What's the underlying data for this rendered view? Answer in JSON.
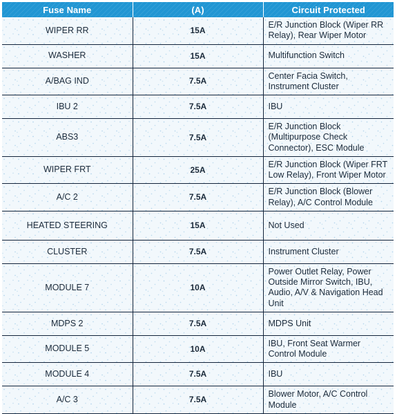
{
  "table": {
    "name": "fuse-relay-table",
    "accent_color": "#2196d3",
    "border_color": "#12233a",
    "body_background": "#f2f8fc",
    "header_text_color": "#ffffff",
    "columns": [
      {
        "key": "fuse_name",
        "label": "Fuse Name"
      },
      {
        "key": "amperage",
        "label": "(A)"
      },
      {
        "key": "circuit_protected",
        "label": "Circuit Protected"
      }
    ],
    "rows": [
      {
        "fuse_name": "WIPER RR",
        "amperage": "15A",
        "circuit_protected": "E/R Junction Block (Wiper RR Relay), Rear Wiper Motor"
      },
      {
        "fuse_name": "WASHER",
        "amperage": "15A",
        "circuit_protected": "Multifunction Switch"
      },
      {
        "fuse_name": "A/BAG IND",
        "amperage": "7.5A",
        "circuit_protected": "Center Facia Switch, Instrument Cluster"
      },
      {
        "fuse_name": "IBU 2",
        "amperage": "7.5A",
        "circuit_protected": "IBU"
      },
      {
        "fuse_name": "ABS3",
        "amperage": "7.5A",
        "circuit_protected": "E/R Junction Block (Multipurpose Check Connector), ESC Module"
      },
      {
        "fuse_name": "WIPER FRT",
        "amperage": "25A",
        "circuit_protected": "E/R Junction Block (Wiper FRT Low Relay), Front Wiper Motor"
      },
      {
        "fuse_name": "A/C 2",
        "amperage": "7.5A",
        "circuit_protected": "E/R Junction Block (Blower Relay), A/C Control Module"
      },
      {
        "fuse_name": "HEATED STEERING",
        "amperage": "15A",
        "circuit_protected": "Not Used"
      },
      {
        "fuse_name": "CLUSTER",
        "amperage": "7.5A",
        "circuit_protected": "Instrument Cluster"
      },
      {
        "fuse_name": "MODULE 7",
        "amperage": "10A",
        "circuit_protected": "Power Outlet Relay, Power Outside Mirror Switch, IBU, Audio, A/V & Navigation Head Unit"
      },
      {
        "fuse_name": "MDPS 2",
        "amperage": "7.5A",
        "circuit_protected": "MDPS Unit"
      },
      {
        "fuse_name": "MODULE 5",
        "amperage": "10A",
        "circuit_protected": "IBU, Front Seat Warmer Control Module"
      },
      {
        "fuse_name": "MODULE 4",
        "amperage": "7.5A",
        "circuit_protected": "IBU"
      },
      {
        "fuse_name": "A/C 3",
        "amperage": "7.5A",
        "circuit_protected": "Blower Motor, A/C Control Module"
      }
    ]
  }
}
